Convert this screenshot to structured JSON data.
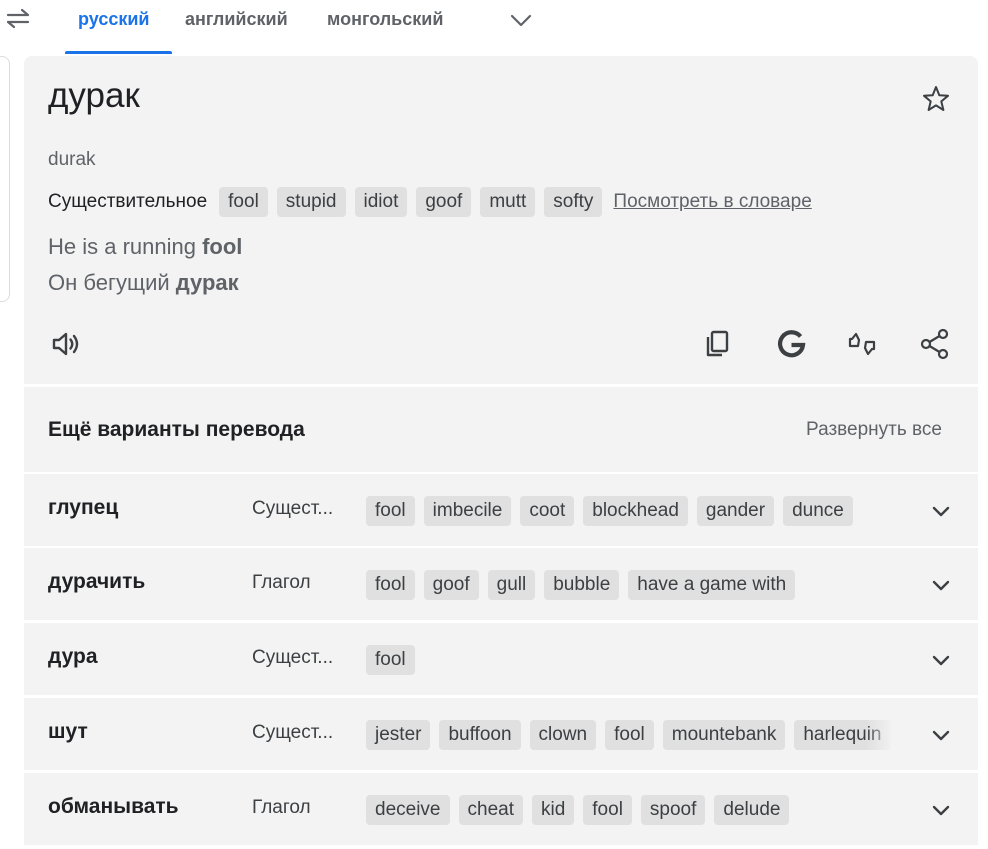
{
  "languages": {
    "tabs": [
      {
        "label": "русский",
        "active": true
      },
      {
        "label": "английский",
        "active": false
      },
      {
        "label": "монгольский",
        "active": false
      }
    ]
  },
  "main": {
    "headword": "дурак",
    "transliteration": "durak",
    "part_of_speech": "Существительное",
    "chips": [
      "fool",
      "stupid",
      "idiot",
      "goof",
      "mutt",
      "softy"
    ],
    "dictionary_link": "Посмотреть в словаре",
    "example_en_prefix": "He is a running ",
    "example_en_bold": "fool",
    "example_ru_prefix": "Он бегущий ",
    "example_ru_bold": "дурак"
  },
  "more": {
    "title": "Ещё варианты перевода",
    "expand_all": "Развернуть все",
    "rows": [
      {
        "word": "глупец",
        "pos": "Сущест...",
        "chips": [
          "fool",
          "imbecile",
          "coot",
          "blockhead",
          "gander",
          "dunce"
        ]
      },
      {
        "word": "дурачить",
        "pos": "Глагол",
        "chips": [
          "fool",
          "goof",
          "gull",
          "bubble",
          "have a game with"
        ]
      },
      {
        "word": "дура",
        "pos": "Сущест...",
        "chips": [
          "fool"
        ]
      },
      {
        "word": "шут",
        "pos": "Сущест...",
        "chips": [
          "jester",
          "buffoon",
          "clown",
          "fool",
          "mountebank",
          "harlequin"
        ]
      },
      {
        "word": "обманывать",
        "pos": "Глагол",
        "chips": [
          "deceive",
          "cheat",
          "kid",
          "fool",
          "spoof",
          "delude"
        ]
      }
    ]
  },
  "icons": {
    "swap": "swap-arrows-icon",
    "more_languages": "chevron-down-icon",
    "favorite": "star-icon",
    "speak": "speaker-icon",
    "copy": "copy-icon",
    "google": "google-icon",
    "feedback": "feedback-icon",
    "share": "share-icon"
  },
  "colors": {
    "accent": "#1a73e8",
    "card_bg": "#f3f3f3",
    "chip_bg": "#e0e0e0"
  }
}
